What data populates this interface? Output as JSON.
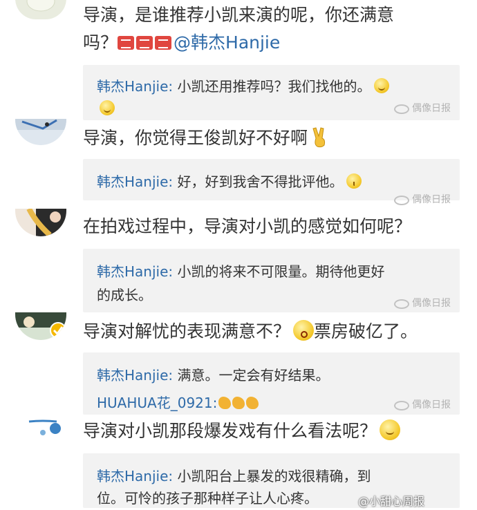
{
  "comments": [
    {
      "line1": "导演，是谁推荐小凯来演的呢，你还满意",
      "line2_prefix": "吗？",
      "mention": "@韩杰Hanjie",
      "reply": {
        "author": "韩杰Hanjie:",
        "line1": " 小凯还用推荐吗？我们找他的。",
        "line2": ""
      }
    },
    {
      "line1": "导演，你觉得王俊凯好不好啊",
      "reply": {
        "author": "韩杰Hanjie:",
        "line1": " 好，好到我舍不得批评他。"
      }
    },
    {
      "line1": "在拍戏过程中，导演对小凯的感觉如何呢？",
      "reply": {
        "author": "韩杰Hanjie:",
        "line1": " 小凯的将来不可限量。期待他更好",
        "line2": "的成长。"
      }
    },
    {
      "line1_a": "导演对解忧的表现满意不？",
      "line1_b": "票房破亿了。",
      "reply": {
        "author": "韩杰Hanjie:",
        "line1": " 满意。一定会有好结果。",
        "sub_author": "HUAHUA花_0921:"
      }
    },
    {
      "line1": "导演对小凯那段爆发戏有什么看法呢？",
      "reply": {
        "author": "韩杰Hanjie:",
        "line1": " 小凯阳台上暴发的戏很精确，到",
        "line2": "位。可怜的孩子那种样子让人心疼。"
      }
    }
  ],
  "watermarks": {
    "small": "偶像日报",
    "bottom": "@小甜心周报"
  },
  "colors": {
    "name_blue": "#2e6aa8",
    "reply_bg": "#f2f2f2",
    "text": "#333333"
  }
}
